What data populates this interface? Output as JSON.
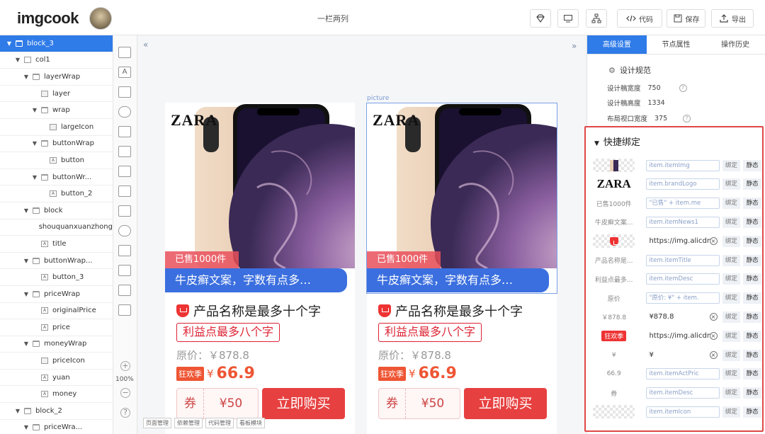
{
  "header": {
    "logo": "imgcook",
    "title": "一栏两列",
    "buttons": {
      "code": "代码",
      "save": "保存",
      "export": "导出"
    }
  },
  "layer_tree": [
    {
      "label": "block_3",
      "depth": 0,
      "caret": "▼",
      "icon": "folder",
      "selected": true
    },
    {
      "label": "col1",
      "depth": 1,
      "caret": "▼",
      "icon": "edit"
    },
    {
      "label": "layerWrap",
      "depth": 2,
      "caret": "▼",
      "icon": "folder"
    },
    {
      "label": "layer",
      "depth": 3,
      "caret": "",
      "icon": "img"
    },
    {
      "label": "wrap",
      "depth": 3,
      "caret": "▼",
      "icon": "folder"
    },
    {
      "label": "largeIcon",
      "depth": 4,
      "caret": "",
      "icon": "img"
    },
    {
      "label": "buttonWrap",
      "depth": 3,
      "caret": "▼",
      "icon": "folder"
    },
    {
      "label": "button",
      "depth": 4,
      "caret": "",
      "icon": "text"
    },
    {
      "label": "buttonWr...",
      "depth": 3,
      "caret": "▼",
      "icon": "folder"
    },
    {
      "label": "button_2",
      "depth": 4,
      "caret": "",
      "icon": "text"
    },
    {
      "label": "block",
      "depth": 2,
      "caret": "▼",
      "icon": "folder"
    },
    {
      "label": "shouquanxuanzhong",
      "depth": 3,
      "caret": "",
      "icon": "none"
    },
    {
      "label": "title",
      "depth": 3,
      "caret": "",
      "icon": "text"
    },
    {
      "label": "buttonWrap...",
      "depth": 2,
      "caret": "▼",
      "icon": "folder"
    },
    {
      "label": "button_3",
      "depth": 3,
      "caret": "",
      "icon": "text"
    },
    {
      "label": "priceWrap",
      "depth": 2,
      "caret": "▼",
      "icon": "folder"
    },
    {
      "label": "originalPrice",
      "depth": 3,
      "caret": "",
      "icon": "text"
    },
    {
      "label": "price",
      "depth": 3,
      "caret": "",
      "icon": "text"
    },
    {
      "label": "moneyWrap",
      "depth": 2,
      "caret": "▼",
      "icon": "folder"
    },
    {
      "label": "priceIcon",
      "depth": 3,
      "caret": "",
      "icon": "img"
    },
    {
      "label": "yuan",
      "depth": 3,
      "caret": "",
      "icon": "text"
    },
    {
      "label": "money",
      "depth": 3,
      "caret": "",
      "icon": "text"
    },
    {
      "label": "block_2",
      "depth": 1,
      "caret": "▼",
      "icon": "folder"
    },
    {
      "label": "priceWra...",
      "depth": 2,
      "caret": "▼",
      "icon": "folder"
    }
  ],
  "zoom": "100%",
  "canvas": {
    "picture_label": "picture",
    "bottom_tabs": [
      "页面管理",
      "依赖管理",
      "代码管理",
      "看板模块"
    ]
  },
  "cards": [
    {
      "brand": "ZARA",
      "sold": "已售1000件",
      "banner": "牛皮癣文案，字数有点多…",
      "name": "产品名称是最多十个字",
      "benefit": "利益点最多八个字",
      "original": "原价：￥878.8",
      "fest": "狂欢季",
      "yuan": "¥",
      "price": "66.9",
      "coupon_q": "券",
      "coupon_v": "¥50",
      "buy": "立即购买"
    },
    {
      "brand": "ZARA",
      "sold": "已售1000件",
      "banner": "牛皮癣文案，字数有点多…",
      "name": "产品名称是最多十个字",
      "benefit": "利益点最多八个字",
      "original": "原价：￥878.8",
      "fest": "狂欢季",
      "yuan": "¥",
      "price": "66.9",
      "coupon_q": "券",
      "coupon_v": "¥50",
      "buy": "立即购买"
    }
  ],
  "right_panel": {
    "tabs": [
      "高级设置",
      "节点属性",
      "操作历史"
    ],
    "spec_title": "设计规范",
    "spec": [
      {
        "label": "设计稿宽度",
        "value": "750"
      },
      {
        "label": "设计稿高度",
        "value": "1334"
      },
      {
        "label": "布局视口宽度",
        "value": "375"
      }
    ],
    "bind_title": "快捷绑定",
    "bindings": [
      {
        "thumb": "",
        "thumb_kind": "img",
        "field": "item.itemImg",
        "kind": "field",
        "clear": false
      },
      {
        "thumb": "ZARA",
        "thumb_kind": "zara",
        "field": "item.brandLogo",
        "kind": "field",
        "clear": false
      },
      {
        "thumb": "已售1000件",
        "thumb_kind": "text",
        "field": "\"已售\" + item.me",
        "kind": "field",
        "clear": false
      },
      {
        "thumb": "牛皮癣文案...",
        "thumb_kind": "text",
        "field": "item.itemNews1",
        "kind": "field",
        "clear": false
      },
      {
        "thumb": "",
        "thumb_kind": "shield",
        "field": "https://img.alicdn.",
        "kind": "plain",
        "clear": true
      },
      {
        "thumb": "产品名称是...",
        "thumb_kind": "text",
        "field": "item.itemTitle",
        "kind": "field",
        "clear": false
      },
      {
        "thumb": "利益点最多...",
        "thumb_kind": "text",
        "field": "item.itemDesc",
        "kind": "field",
        "clear": false
      },
      {
        "thumb": "原价",
        "thumb_kind": "text",
        "field": "\"原价: ¥\" + item.",
        "kind": "field",
        "clear": false
      },
      {
        "thumb": "￥878.8",
        "thumb_kind": "text",
        "field": "¥878.8",
        "kind": "plain",
        "clear": true
      },
      {
        "thumb": "狂欢季",
        "thumb_kind": "pill",
        "field": "https://img.alicdn.",
        "kind": "plain",
        "clear": true
      },
      {
        "thumb": "¥",
        "thumb_kind": "text",
        "field": "¥",
        "kind": "plain",
        "clear": true
      },
      {
        "thumb": "66.9",
        "thumb_kind": "text",
        "field": "item.itemActPric",
        "kind": "field",
        "clear": false
      },
      {
        "thumb": "券",
        "thumb_kind": "text",
        "field": "item.itemDesc",
        "kind": "field",
        "clear": false
      },
      {
        "thumb": "",
        "thumb_kind": "checker",
        "field": "item.itemIcon",
        "kind": "field",
        "clear": false
      }
    ],
    "bind_btn": "绑定",
    "static_btn": "静态"
  }
}
